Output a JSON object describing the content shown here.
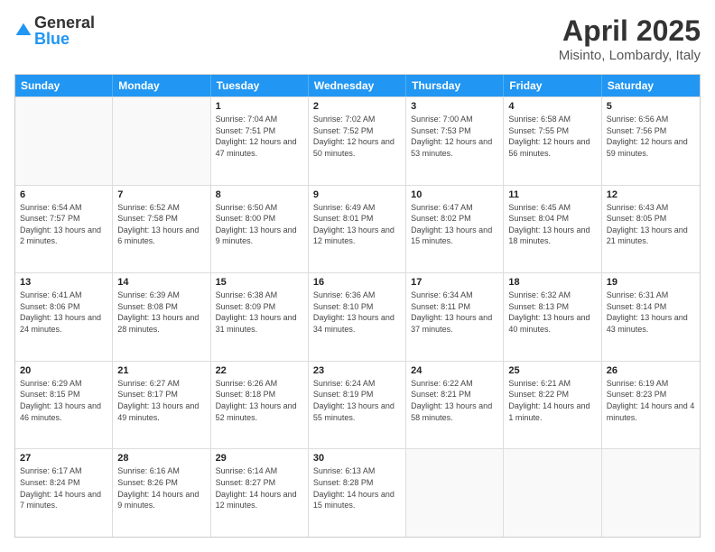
{
  "logo": {
    "general": "General",
    "blue": "Blue"
  },
  "title": "April 2025",
  "subtitle": "Misinto, Lombardy, Italy",
  "header_days": [
    "Sunday",
    "Monday",
    "Tuesday",
    "Wednesday",
    "Thursday",
    "Friday",
    "Saturday"
  ],
  "weeks": [
    [
      {
        "day": "",
        "sunrise": "",
        "sunset": "",
        "daylight": ""
      },
      {
        "day": "",
        "sunrise": "",
        "sunset": "",
        "daylight": ""
      },
      {
        "day": "1",
        "sunrise": "Sunrise: 7:04 AM",
        "sunset": "Sunset: 7:51 PM",
        "daylight": "Daylight: 12 hours and 47 minutes."
      },
      {
        "day": "2",
        "sunrise": "Sunrise: 7:02 AM",
        "sunset": "Sunset: 7:52 PM",
        "daylight": "Daylight: 12 hours and 50 minutes."
      },
      {
        "day": "3",
        "sunrise": "Sunrise: 7:00 AM",
        "sunset": "Sunset: 7:53 PM",
        "daylight": "Daylight: 12 hours and 53 minutes."
      },
      {
        "day": "4",
        "sunrise": "Sunrise: 6:58 AM",
        "sunset": "Sunset: 7:55 PM",
        "daylight": "Daylight: 12 hours and 56 minutes."
      },
      {
        "day": "5",
        "sunrise": "Sunrise: 6:56 AM",
        "sunset": "Sunset: 7:56 PM",
        "daylight": "Daylight: 12 hours and 59 minutes."
      }
    ],
    [
      {
        "day": "6",
        "sunrise": "Sunrise: 6:54 AM",
        "sunset": "Sunset: 7:57 PM",
        "daylight": "Daylight: 13 hours and 2 minutes."
      },
      {
        "day": "7",
        "sunrise": "Sunrise: 6:52 AM",
        "sunset": "Sunset: 7:58 PM",
        "daylight": "Daylight: 13 hours and 6 minutes."
      },
      {
        "day": "8",
        "sunrise": "Sunrise: 6:50 AM",
        "sunset": "Sunset: 8:00 PM",
        "daylight": "Daylight: 13 hours and 9 minutes."
      },
      {
        "day": "9",
        "sunrise": "Sunrise: 6:49 AM",
        "sunset": "Sunset: 8:01 PM",
        "daylight": "Daylight: 13 hours and 12 minutes."
      },
      {
        "day": "10",
        "sunrise": "Sunrise: 6:47 AM",
        "sunset": "Sunset: 8:02 PM",
        "daylight": "Daylight: 13 hours and 15 minutes."
      },
      {
        "day": "11",
        "sunrise": "Sunrise: 6:45 AM",
        "sunset": "Sunset: 8:04 PM",
        "daylight": "Daylight: 13 hours and 18 minutes."
      },
      {
        "day": "12",
        "sunrise": "Sunrise: 6:43 AM",
        "sunset": "Sunset: 8:05 PM",
        "daylight": "Daylight: 13 hours and 21 minutes."
      }
    ],
    [
      {
        "day": "13",
        "sunrise": "Sunrise: 6:41 AM",
        "sunset": "Sunset: 8:06 PM",
        "daylight": "Daylight: 13 hours and 24 minutes."
      },
      {
        "day": "14",
        "sunrise": "Sunrise: 6:39 AM",
        "sunset": "Sunset: 8:08 PM",
        "daylight": "Daylight: 13 hours and 28 minutes."
      },
      {
        "day": "15",
        "sunrise": "Sunrise: 6:38 AM",
        "sunset": "Sunset: 8:09 PM",
        "daylight": "Daylight: 13 hours and 31 minutes."
      },
      {
        "day": "16",
        "sunrise": "Sunrise: 6:36 AM",
        "sunset": "Sunset: 8:10 PM",
        "daylight": "Daylight: 13 hours and 34 minutes."
      },
      {
        "day": "17",
        "sunrise": "Sunrise: 6:34 AM",
        "sunset": "Sunset: 8:11 PM",
        "daylight": "Daylight: 13 hours and 37 minutes."
      },
      {
        "day": "18",
        "sunrise": "Sunrise: 6:32 AM",
        "sunset": "Sunset: 8:13 PM",
        "daylight": "Daylight: 13 hours and 40 minutes."
      },
      {
        "day": "19",
        "sunrise": "Sunrise: 6:31 AM",
        "sunset": "Sunset: 8:14 PM",
        "daylight": "Daylight: 13 hours and 43 minutes."
      }
    ],
    [
      {
        "day": "20",
        "sunrise": "Sunrise: 6:29 AM",
        "sunset": "Sunset: 8:15 PM",
        "daylight": "Daylight: 13 hours and 46 minutes."
      },
      {
        "day": "21",
        "sunrise": "Sunrise: 6:27 AM",
        "sunset": "Sunset: 8:17 PM",
        "daylight": "Daylight: 13 hours and 49 minutes."
      },
      {
        "day": "22",
        "sunrise": "Sunrise: 6:26 AM",
        "sunset": "Sunset: 8:18 PM",
        "daylight": "Daylight: 13 hours and 52 minutes."
      },
      {
        "day": "23",
        "sunrise": "Sunrise: 6:24 AM",
        "sunset": "Sunset: 8:19 PM",
        "daylight": "Daylight: 13 hours and 55 minutes."
      },
      {
        "day": "24",
        "sunrise": "Sunrise: 6:22 AM",
        "sunset": "Sunset: 8:21 PM",
        "daylight": "Daylight: 13 hours and 58 minutes."
      },
      {
        "day": "25",
        "sunrise": "Sunrise: 6:21 AM",
        "sunset": "Sunset: 8:22 PM",
        "daylight": "Daylight: 14 hours and 1 minute."
      },
      {
        "day": "26",
        "sunrise": "Sunrise: 6:19 AM",
        "sunset": "Sunset: 8:23 PM",
        "daylight": "Daylight: 14 hours and 4 minutes."
      }
    ],
    [
      {
        "day": "27",
        "sunrise": "Sunrise: 6:17 AM",
        "sunset": "Sunset: 8:24 PM",
        "daylight": "Daylight: 14 hours and 7 minutes."
      },
      {
        "day": "28",
        "sunrise": "Sunrise: 6:16 AM",
        "sunset": "Sunset: 8:26 PM",
        "daylight": "Daylight: 14 hours and 9 minutes."
      },
      {
        "day": "29",
        "sunrise": "Sunrise: 6:14 AM",
        "sunset": "Sunset: 8:27 PM",
        "daylight": "Daylight: 14 hours and 12 minutes."
      },
      {
        "day": "30",
        "sunrise": "Sunrise: 6:13 AM",
        "sunset": "Sunset: 8:28 PM",
        "daylight": "Daylight: 14 hours and 15 minutes."
      },
      {
        "day": "",
        "sunrise": "",
        "sunset": "",
        "daylight": ""
      },
      {
        "day": "",
        "sunrise": "",
        "sunset": "",
        "daylight": ""
      },
      {
        "day": "",
        "sunrise": "",
        "sunset": "",
        "daylight": ""
      }
    ]
  ]
}
